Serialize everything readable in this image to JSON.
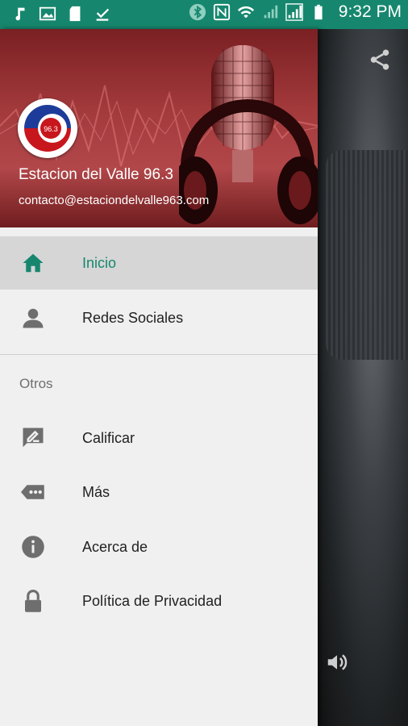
{
  "status_bar": {
    "time": "9:32 PM"
  },
  "drawer": {
    "station_name": "Estacion del Valle 96.3",
    "email": "contacto@estaciondelvalle963.com",
    "logo_text": "96.3",
    "menu": [
      {
        "label": "Inicio",
        "icon": "home-icon",
        "active": true
      },
      {
        "label": "Redes Sociales",
        "icon": "person-icon",
        "active": false
      }
    ],
    "section_title": "Otros",
    "other_items": [
      {
        "label": "Calificar",
        "icon": "rate-review-icon"
      },
      {
        "label": "Más",
        "icon": "more-icon"
      },
      {
        "label": "Acerca de",
        "icon": "info-icon"
      },
      {
        "label": "Política de Privacidad",
        "icon": "lock-icon"
      }
    ]
  },
  "colors": {
    "accent": "#16876e",
    "header_red": "#a2393b"
  }
}
